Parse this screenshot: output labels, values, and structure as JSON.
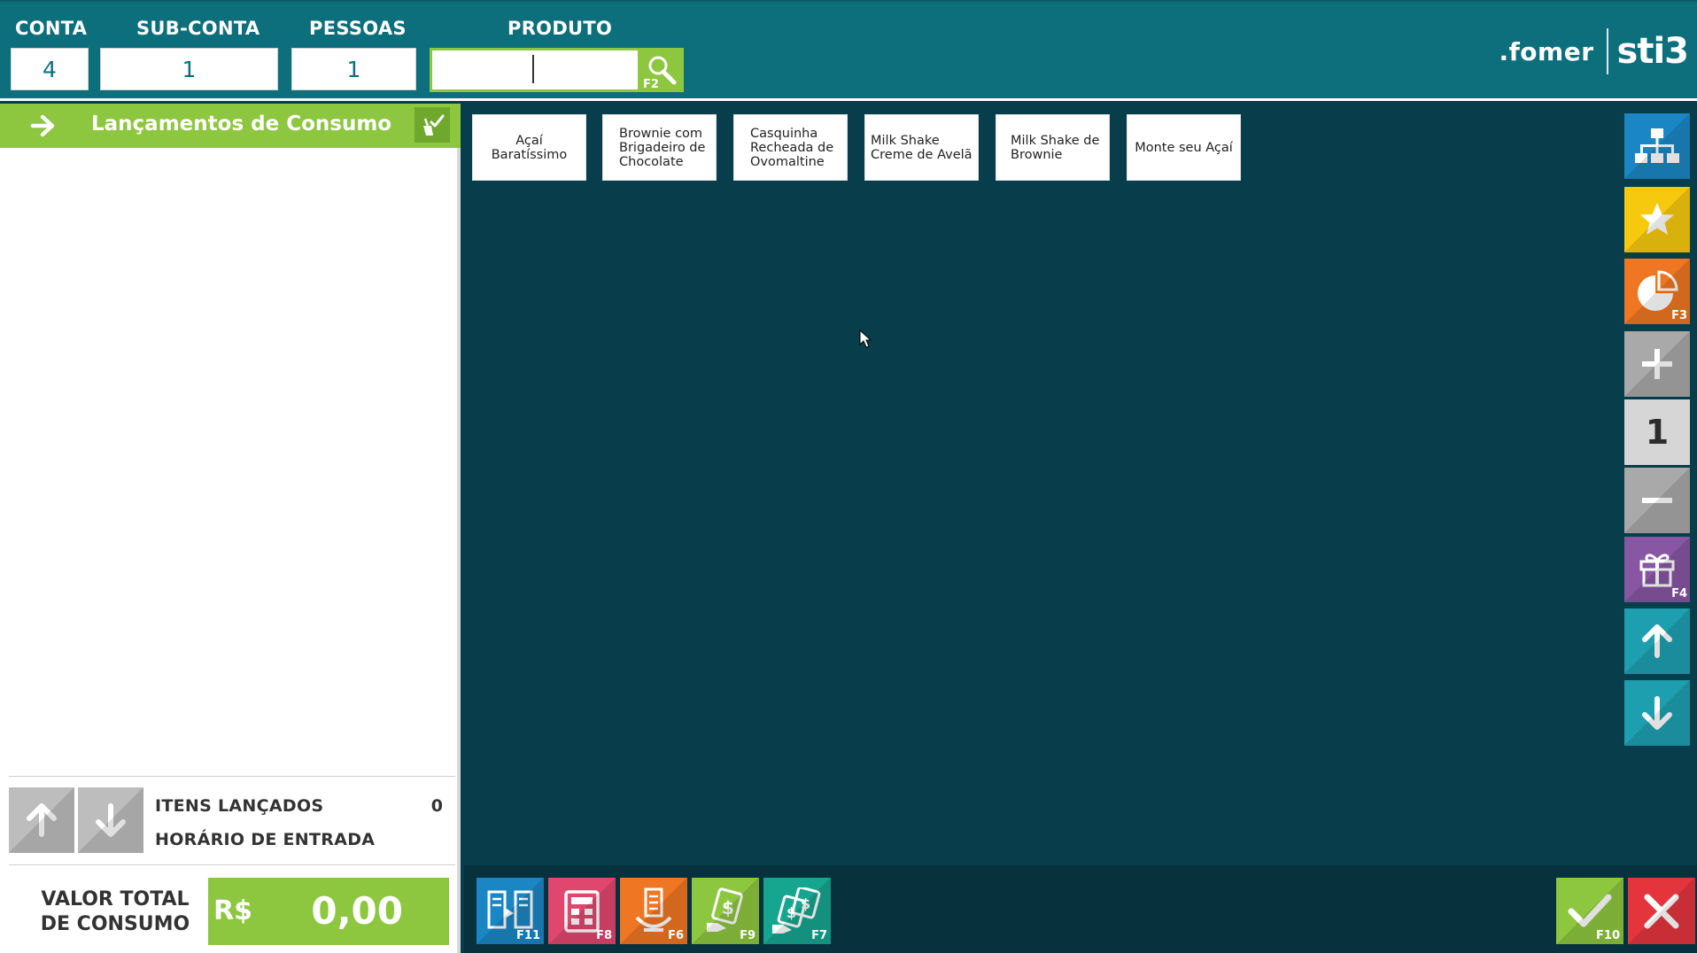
{
  "header": {
    "conta_label": "CONTA",
    "subconta_label": "SUB-CONTA",
    "pessoas_label": "PESSOAS",
    "produto_label": "PRODUTO",
    "conta_value": "4",
    "subconta_value": "1",
    "pessoas_value": "1",
    "produto_value": "",
    "search_key": "F2",
    "brand_fomer": ".fomer",
    "brand_sti3": "sti3"
  },
  "consumo": {
    "title": "Lançamentos de Consumo",
    "itens_label": "ITENS LANÇADOS",
    "itens_count": "0",
    "horario_label": "HORÁRIO DE ENTRADA",
    "horario_value": "",
    "total_label_line1": "VALOR TOTAL",
    "total_label_line2": "DE CONSUMO",
    "currency": "R$",
    "total_value": "0,00"
  },
  "products": [
    "Açaí Baratíssimo",
    "Brownie com Brigadeiro de Chocolate",
    "Casquinha Recheada de Ovomaltine",
    "Milk Shake Creme de Avelã",
    "Milk Shake de Brownie",
    "Monte seu Açaí"
  ],
  "side_toolbar": {
    "categories_icon": "sitemap-icon",
    "favorites_icon": "star-icon",
    "stats_icon": "pie-chart-icon",
    "stats_key": "F3",
    "increase_icon": "plus-icon",
    "quantity": "1",
    "decrease_icon": "minus-icon",
    "gift_icon": "gift-icon",
    "gift_key": "F4",
    "up_icon": "arrow-up-icon",
    "down_icon": "arrow-down-icon"
  },
  "bottom_toolbar": {
    "transfer_key": "F11",
    "calculator_key": "F8",
    "service_key": "F6",
    "payment_key": "F9",
    "multi_payment_key": "F7",
    "confirm_key": "F10"
  },
  "colors": {
    "header_bg": "#0d6f7c",
    "main_bg": "#083d4b",
    "accent_green": "#8dc63f",
    "blue": "#1a86c4",
    "yellow": "#f6c90e",
    "orange": "#ef7622",
    "purple": "#8757a3",
    "teal": "#1d9fb0",
    "pink": "#e0476e",
    "red": "#e4343c"
  }
}
